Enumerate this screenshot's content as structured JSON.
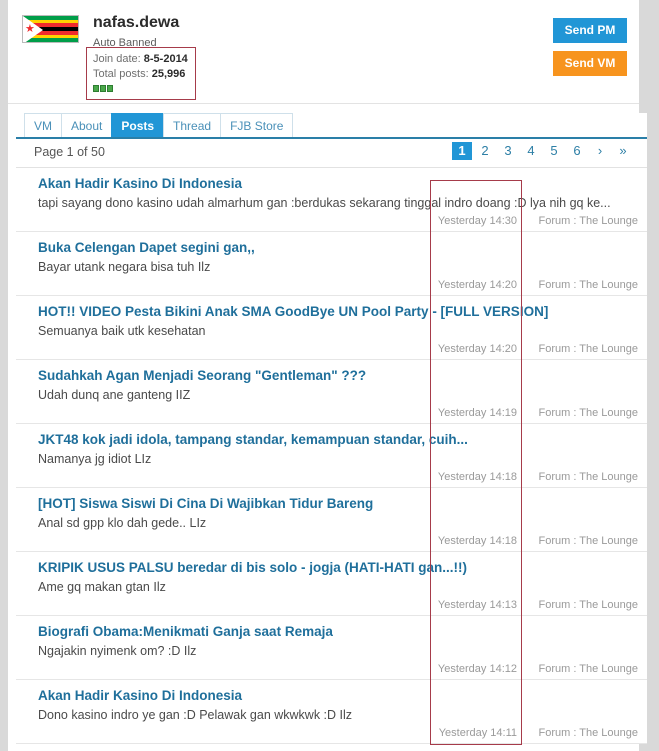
{
  "profile": {
    "flag_icon": "zimbabwe-flag-icon",
    "username": "nafas.dewa",
    "status": "Auto Banned",
    "join_date_label": "Join date: ",
    "join_date_value": "8-5-2014",
    "total_posts_label": "Total posts: ",
    "total_posts_value": "25,996",
    "reputation_bars": 3,
    "buttons": {
      "send_pm": "Send PM",
      "send_vm": "Send VM"
    },
    "colors": {
      "send_pm_bg": "#2196d6",
      "send_vm_bg": "#f7941e",
      "annotation_border": "#a63b4a"
    }
  },
  "tabs": [
    {
      "label": "VM",
      "active": false
    },
    {
      "label": "About",
      "active": false
    },
    {
      "label": "Posts",
      "active": true
    },
    {
      "label": "Thread",
      "active": false
    },
    {
      "label": "FJB Store",
      "active": false
    }
  ],
  "pagination": {
    "page_info": "Page 1 of 50",
    "pages": [
      "1",
      "2",
      "3",
      "4",
      "5",
      "6"
    ],
    "current": "1",
    "next_icon": "›",
    "last_icon": "»"
  },
  "threads": [
    {
      "title": "Akan Hadir Kasino Di Indonesia",
      "snippet": "tapi sayang dono kasino udah almarhum gan :berdukas sekarang tinggal indro doang :D lya nih gq ke...",
      "date": "Yesterday 14:30",
      "forum": "Forum : The Lounge"
    },
    {
      "title": "Buka Celengan Dapet segini gan,,",
      "snippet": "Bayar utank negara bisa tuh Ilz",
      "date": "Yesterday 14:20",
      "forum": "Forum : The Lounge"
    },
    {
      "title": "HOT!! VIDEO Pesta Bikini Anak SMA GoodBye UN Pool Party - [FULL VERSION]",
      "snippet": "Semuanya baik utk kesehatan",
      "date": "Yesterday 14:20",
      "forum": "Forum : The Lounge"
    },
    {
      "title": "Sudahkah Agan Menjadi Seorang \"Gentleman\" ???",
      "snippet": "Udah dunq ane ganteng IIZ",
      "date": "Yesterday 14:19",
      "forum": "Forum : The Lounge"
    },
    {
      "title": "JKT48 kok jadi idola, tampang standar, kemampuan standar, cuih...",
      "snippet": "Namanya jg idiot LIz",
      "date": "Yesterday 14:18",
      "forum": "Forum : The Lounge"
    },
    {
      "title": "[HOT] Siswa Siswi Di Cina Di Wajibkan Tidur Bareng",
      "snippet": "Anal sd gpp klo dah gede.. LIz",
      "date": "Yesterday 14:18",
      "forum": "Forum : The Lounge"
    },
    {
      "title": "KRIPIK USUS PALSU beredar di bis solo - jogja (HATI-HATI gan...!!)",
      "snippet": "Ame gq makan gtan Ilz",
      "date": "Yesterday 14:13",
      "forum": "Forum : The Lounge"
    },
    {
      "title": "Biografi Obama:Menikmati Ganja saat Remaja",
      "snippet": "Ngajakin nyimenk om? :D Ilz",
      "date": "Yesterday 14:12",
      "forum": "Forum : The Lounge"
    },
    {
      "title": "Akan Hadir Kasino Di Indonesia",
      "snippet": "Dono kasino indro ye gan :D Pelawak gan wkwkwk :D Ilz",
      "date": "Yesterday 14:11",
      "forum": "Forum : The Lounge"
    }
  ]
}
